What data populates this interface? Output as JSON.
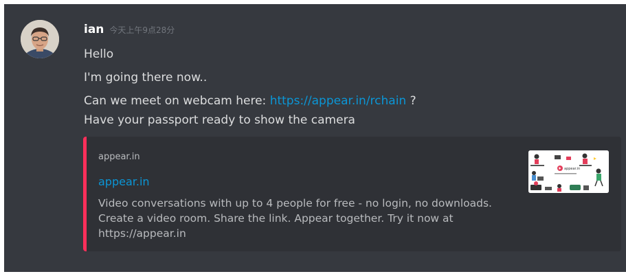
{
  "message": {
    "username": "ian",
    "timestamp": "今天上午9点28分",
    "lines": [
      "Hello",
      "I'm going there now..",
      "Can we meet on webcam here: ",
      "Have your passport ready to show the camera"
    ],
    "link_text": "https://appear.in/rchain",
    "link_suffix": " ?"
  },
  "embed": {
    "provider": "appear.in",
    "title": "appear.in",
    "description": "Video conversations with up to 4 people for free - no login, no downloads. Create a video room. Share the link. Appear together. Try it now at https://appear.in",
    "thumbnail_caption": "appear.in",
    "accent_color": "#ff2f5a"
  },
  "colors": {
    "background": "#36393f",
    "embed_background": "#2f3136",
    "link": "#0b96d6",
    "text": "#dcddde",
    "muted": "#72767d"
  }
}
